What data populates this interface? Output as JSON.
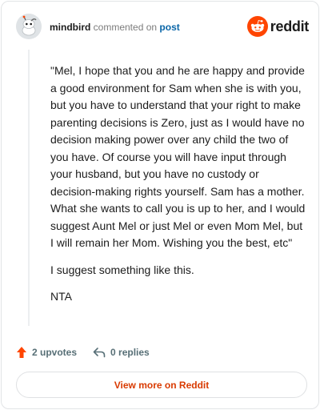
{
  "header": {
    "username": "mindbird",
    "action_text": "commented on",
    "post_link": "post",
    "brand": "reddit"
  },
  "comment": {
    "paragraphs": [
      "\"Mel, I hope that you and he are happy and provide a good environment for Sam when she is with you, but you have to understand that your right to make parenting decisions is Zero, just as I would have no decision making power over any child the two of you have. Of course you will have input through your husband, but you have no custody or decision-making rights yourself. Sam has a mother. What she wants to call you is up to her, and I would suggest Aunt Mel or just Mel or even Mom Mel, but I will remain her Mom. Wishing you the best, etc\"",
      "I suggest something like this.",
      "NTA"
    ]
  },
  "actions": {
    "upvotes": "2 upvotes",
    "replies": "0 replies"
  },
  "footer": {
    "view_more": "View more on Reddit"
  },
  "colors": {
    "accent": "#d93a00",
    "upvote": "#ff4500",
    "link": "#0a66a8",
    "muted": "#576f76"
  },
  "icons": {
    "avatar": "snoo-avatar-icon",
    "logo": "reddit-logo-icon",
    "upvote": "upvote-arrow-icon",
    "reply": "reply-arrow-icon"
  }
}
